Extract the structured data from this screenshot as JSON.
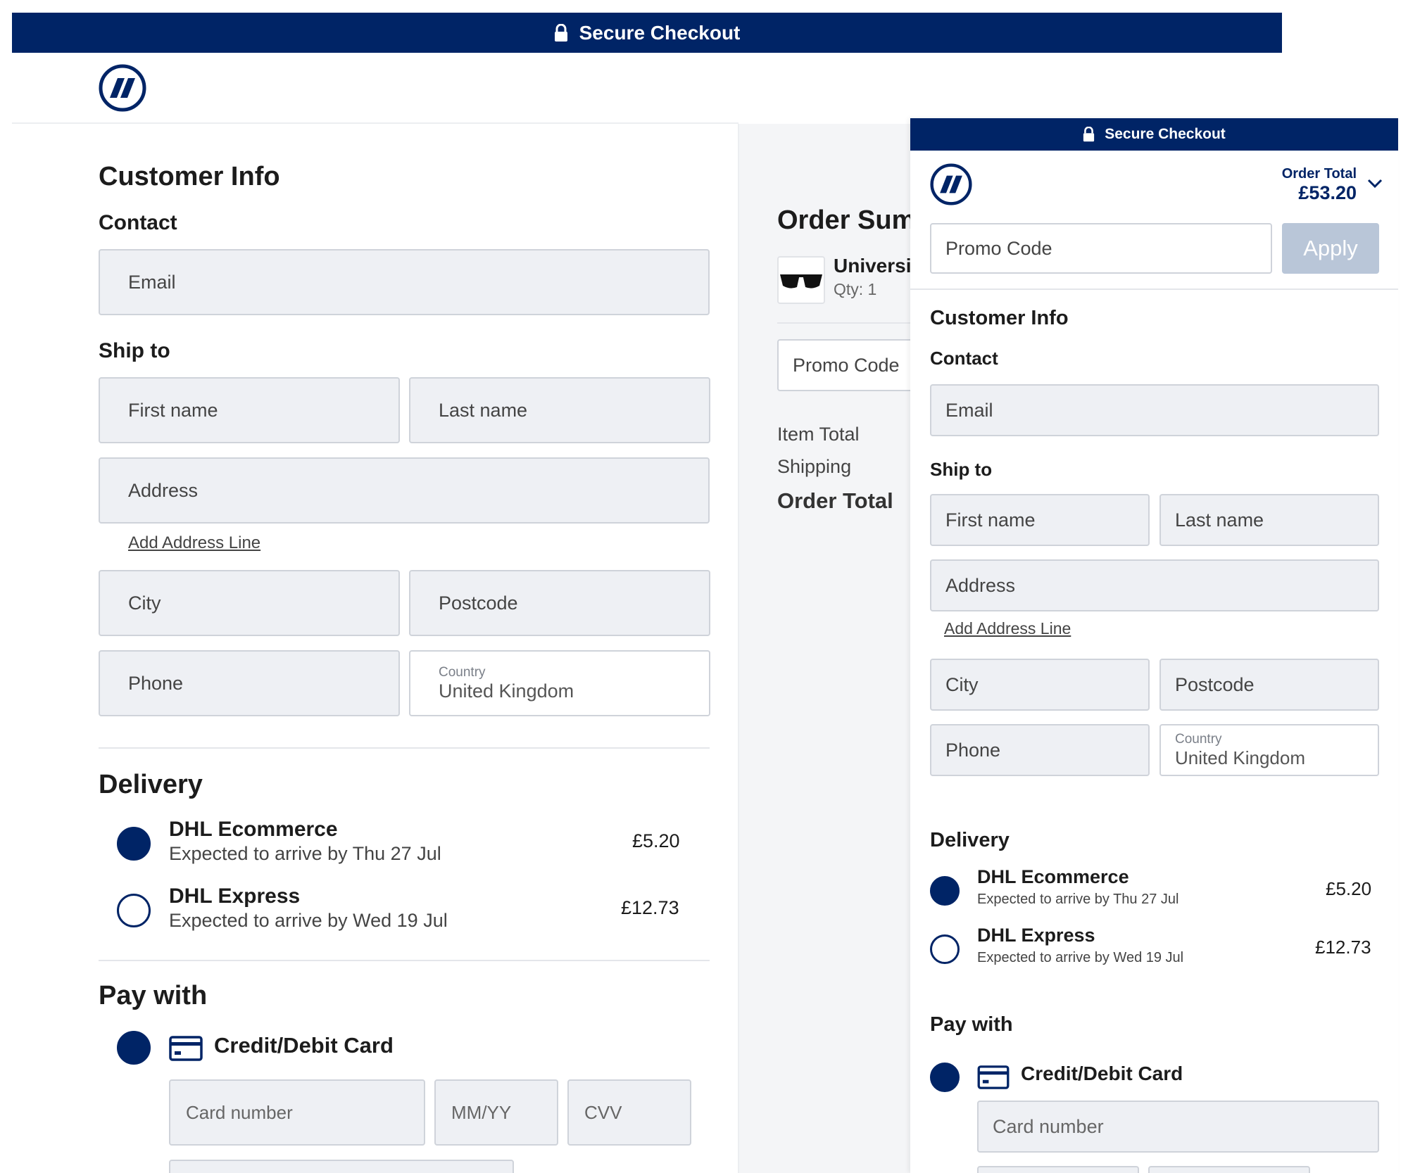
{
  "main": {
    "topbar": {
      "title": "Secure Checkout"
    },
    "customer_info": {
      "title": "Customer Info",
      "contact_label": "Contact",
      "email_placeholder": "Email",
      "ship_to_label": "Ship to",
      "first_name_placeholder": "First name",
      "last_name_placeholder": "Last name",
      "address_placeholder": "Address",
      "add_address_line": "Add Address Line",
      "city_placeholder": "City",
      "postcode_placeholder": "Postcode",
      "phone_placeholder": "Phone",
      "country_label": "Country",
      "country_value": "United Kingdom"
    },
    "delivery": {
      "title": "Delivery",
      "options": [
        {
          "name": "DHL Ecommerce",
          "eta": "Expected to arrive by Thu 27 Jul",
          "price": "£5.20",
          "selected": true
        },
        {
          "name": "DHL Express",
          "eta": "Expected to arrive by Wed 19 Jul",
          "price": "£12.73",
          "selected": false
        }
      ]
    },
    "pay_with": {
      "title": "Pay with",
      "method": "Credit/Debit Card",
      "card_number_placeholder": "Card number",
      "expiry_placeholder": "MM/YY",
      "cvv_placeholder": "CVV"
    },
    "order_summary": {
      "title": "Order Sum",
      "item_name": "Universit",
      "item_qty": "Qty: 1",
      "promo_placeholder": "Promo Code",
      "item_total_label": "Item Total",
      "shipping_label": "Shipping",
      "order_total_label": "Order Total"
    }
  },
  "panel": {
    "topbar": {
      "title": "Secure Checkout"
    },
    "order_total": {
      "label": "Order Total",
      "value": "£53.20"
    },
    "promo": {
      "placeholder": "Promo Code",
      "apply_label": "Apply"
    },
    "customer_info": {
      "title": "Customer Info",
      "contact_label": "Contact",
      "email_placeholder": "Email",
      "ship_to_label": "Ship to",
      "first_name_placeholder": "First name",
      "last_name_placeholder": "Last name",
      "address_placeholder": "Address",
      "add_address_line": "Add Address Line",
      "city_placeholder": "City",
      "postcode_placeholder": "Postcode",
      "phone_placeholder": "Phone",
      "country_label": "Country",
      "country_value": "United Kingdom"
    },
    "delivery": {
      "title": "Delivery",
      "options": [
        {
          "name": "DHL Ecommerce",
          "eta": "Expected to arrive by Thu 27 Jul",
          "price": "£5.20",
          "selected": true
        },
        {
          "name": "DHL Express",
          "eta": "Expected to arrive by Wed 19 Jul",
          "price": "£12.73",
          "selected": false
        }
      ]
    },
    "pay_with": {
      "title": "Pay with",
      "method": "Credit/Debit Card",
      "card_number_placeholder": "Card number"
    }
  },
  "colors": {
    "brand_navy": "#002466",
    "field_bg": "#eef0f4",
    "field_border": "#cfd3da",
    "apply_disabled": "#b9c6d8"
  },
  "icons": [
    "lock-icon",
    "brand-logo-icon",
    "credit-card-icon",
    "chevron-down-icon",
    "sunglasses-product-image"
  ]
}
